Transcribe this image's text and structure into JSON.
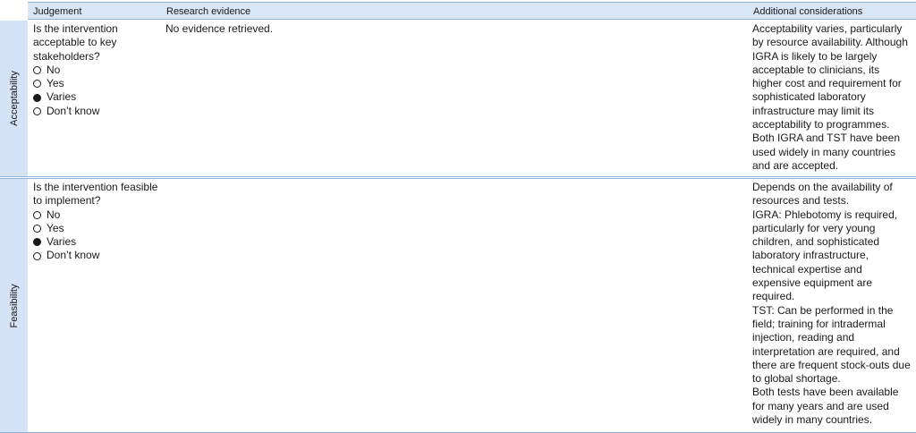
{
  "headers": {
    "judgement": "Judgement",
    "evidence": "Research evidence",
    "additional": "Additional considerations"
  },
  "rows": [
    {
      "side_label": "Acceptability",
      "question": "Is the intervention acceptable to key stakeholders?",
      "options": [
        {
          "label": "No",
          "selected": false
        },
        {
          "label": "Yes",
          "selected": false
        },
        {
          "label": "Varies",
          "selected": true
        },
        {
          "label": "Don’t know",
          "selected": false
        }
      ],
      "evidence": "No evidence retrieved.",
      "additional": [
        "Acceptability varies, particularly by resource availability. Although IGRA is likely to be largely acceptable to clinicians, its higher cost and requirement for sophisticated laboratory infrastructure may limit its acceptability to programmes. Both IGRA and TST have been used widely in many countries and are accepted."
      ]
    },
    {
      "side_label": "Feasibility",
      "question": "Is the intervention feasible to implement?",
      "options": [
        {
          "label": "No",
          "selected": false
        },
        {
          "label": "Yes",
          "selected": false
        },
        {
          "label": "Varies",
          "selected": true
        },
        {
          "label": "Don’t know",
          "selected": false
        }
      ],
      "evidence": "",
      "additional": [
        "Depends on the availability of resources and tests.",
        "IGRA: Phlebotomy is required, particularly for very young children, and sophisticated laboratory infrastructure, technical expertise and expensive equipment are required.",
        "TST: Can be performed in the field; training for intradermal injection, reading and interpretation are required, and there are frequent stock-outs due to global shortage.",
        "Both tests have been available for many years and are used widely in many countries."
      ]
    }
  ]
}
